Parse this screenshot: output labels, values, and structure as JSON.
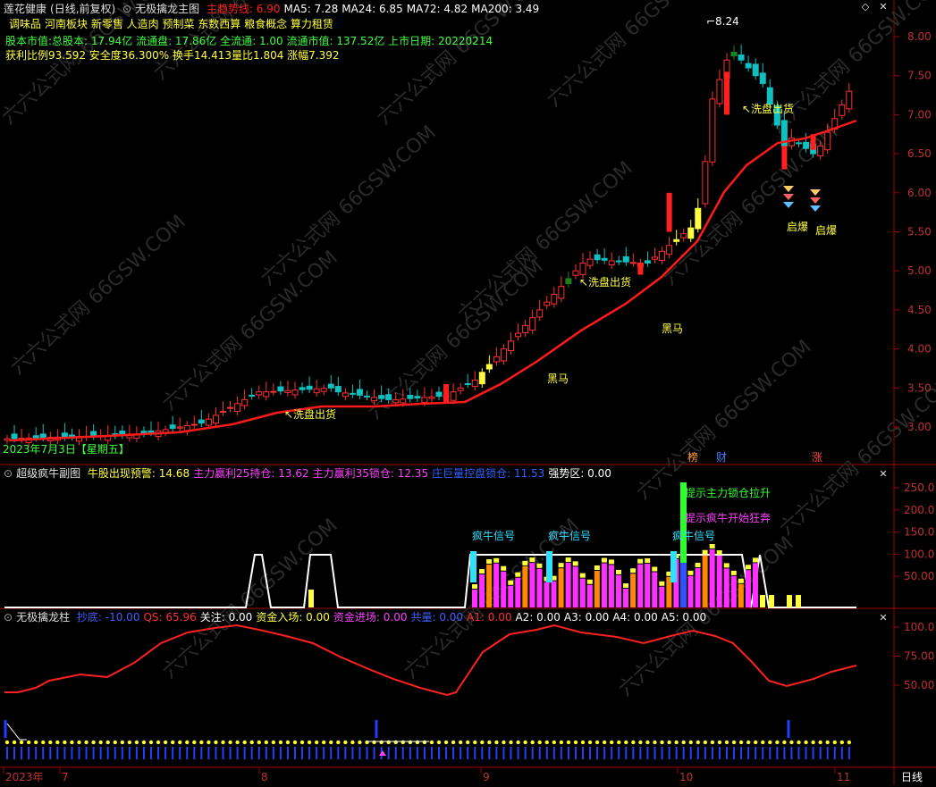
{
  "main": {
    "title": "莲花健康",
    "mode": "(日线,前复权)",
    "indicator_name": "无极擒龙主图",
    "ma_items": [
      {
        "label": "主趋势线: 6.90",
        "color": "#ff2020"
      },
      {
        "label": "MA5: 7.28",
        "color": "#ffffff"
      },
      {
        "label": "MA24: 6.85",
        "color": "#ffffff"
      },
      {
        "label": "MA72: 4.82",
        "color": "#ffffff"
      },
      {
        "label": "MA200: 3.49",
        "color": "#ffffff"
      }
    ],
    "concept_prefix": "调味品",
    "concepts": "河南板块 新零售 人造肉 预制菜 东数西算 粮食概念 算力租赁",
    "info_line1": "股本市值:总股本: 17.94亿 流通盘: 17.86亿 全流通: 1.00 流通市值: 137.52亿 上市日期: 20220214",
    "info_line2": "获利比例93.592 安全度36.300% 换手14.413量比1.804 涨幅7.392",
    "date_label": "2023年7月3日【星期五】",
    "high_label": "8.24",
    "annotations": [
      "洗盘出货",
      "洗盘出货",
      "洗盘出货",
      "黑马",
      "黑马",
      "启爆",
      "启爆"
    ],
    "tags": [
      "榜",
      "财",
      "涨"
    ],
    "yaxis": [
      "8.00",
      "7.50",
      "7.00",
      "6.50",
      "6.00",
      "5.50",
      "5.00",
      "4.50",
      "4.00",
      "3.50",
      "3.00"
    ]
  },
  "sub1": {
    "name": "超级疯牛副图",
    "items": [
      {
        "label": "牛股出现预警: 14.68",
        "color": "#ffff40"
      },
      {
        "label": "主力赢利25持仓: 13.62",
        "color": "#ff40ff"
      },
      {
        "label": "主力赢利35锁仓: 12.35",
        "color": "#ff40ff"
      },
      {
        "label": "庄巨量控盘锁仓: 11.53",
        "color": "#3060ff"
      },
      {
        "label": "强势区: 0.00",
        "color": "#ffffff"
      }
    ],
    "signals": [
      "疯牛信号",
      "疯牛信号",
      "疯牛信号"
    ],
    "note1": "提示主力锁仓拉升",
    "note2": "提示疯牛开始狂奔",
    "yaxis": [
      "250.0",
      "200.0",
      "150.0",
      "100.0",
      "50.00"
    ]
  },
  "sub2": {
    "name": "无极擒龙柱",
    "items": [
      {
        "label": "抄底: -10.00",
        "color": "#4060ff"
      },
      {
        "label": "QS: 65.96",
        "color": "#ff3030"
      },
      {
        "label": "关注: 0.00",
        "color": "#ffffff"
      },
      {
        "label": "资金入场: 0.00",
        "color": "#ffff40"
      },
      {
        "label": "资金进场: 0.00",
        "color": "#ff40ff"
      },
      {
        "label": "共量: 0.00",
        "color": "#4060ff"
      },
      {
        "label": "A1: 0.00",
        "color": "#ff3030"
      },
      {
        "label": "A2: 0.00",
        "color": "#ffffff"
      },
      {
        "label": "A3: 0.00",
        "color": "#ffffff"
      },
      {
        "label": "A4: 0.00",
        "color": "#ffffff"
      },
      {
        "label": "A5: 0.00",
        "color": "#ffffff"
      }
    ],
    "yaxis": [
      "100.0",
      "75.00",
      "50.00"
    ]
  },
  "xaxis": {
    "labels": [
      "2023年",
      "7",
      "8",
      "9",
      "10",
      "11"
    ],
    "period": "日线"
  },
  "watermark": "六六公式网 66GSW.COM"
}
